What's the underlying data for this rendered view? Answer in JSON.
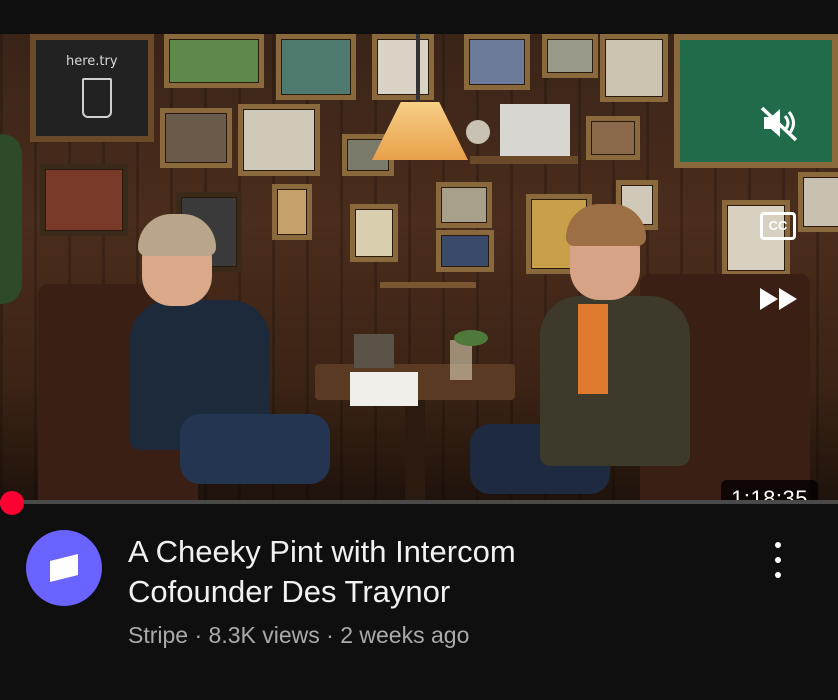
{
  "player": {
    "chalkboard_text": "here.try",
    "duration": "1:18:35",
    "cc_label": "CC",
    "progress_fraction": 0.0,
    "controls": {
      "mute_icon": "muted-speaker-icon",
      "cc_icon": "closed-captions-icon",
      "forward_icon": "fast-forward-icon"
    },
    "accent_color": "#ff0033"
  },
  "video": {
    "title_line1": "A Cheeky Pint with Intercom",
    "title_line2": "Cofounder Des Traynor",
    "channel": "Stripe",
    "sep1": "·",
    "views": "8.3K views",
    "sep2": "·",
    "age": "2 weeks ago",
    "avatar_color": "#6b63ff",
    "menu_icon": "more-vertical-icon"
  }
}
